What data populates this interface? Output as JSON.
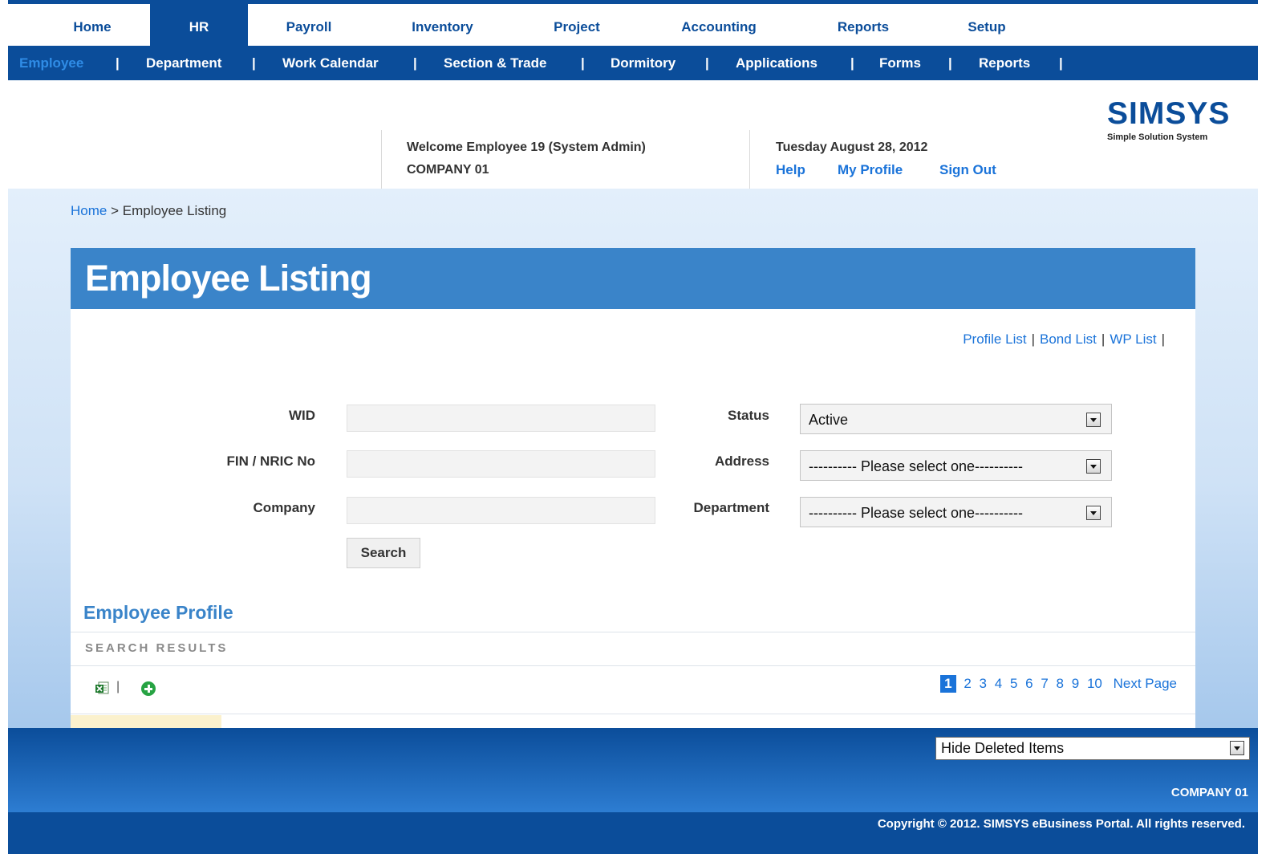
{
  "main_nav": {
    "tabs": [
      {
        "label": "Home"
      },
      {
        "label": "HR",
        "active": true
      },
      {
        "label": "Payroll"
      },
      {
        "label": "Inventory"
      },
      {
        "label": "Project"
      },
      {
        "label": "Accounting"
      },
      {
        "label": "Reports"
      },
      {
        "label": "Setup"
      }
    ]
  },
  "sub_nav": {
    "items": [
      {
        "label": "Employee",
        "active": true
      },
      {
        "label": "Department"
      },
      {
        "label": "Work Calendar"
      },
      {
        "label": "Section & Trade"
      },
      {
        "label": "Dormitory"
      },
      {
        "label": "Applications"
      },
      {
        "label": "Forms"
      },
      {
        "label": "Reports"
      }
    ],
    "separator": "|"
  },
  "header": {
    "welcome": "Welcome Employee 19 (System Admin)",
    "company": "COMPANY 01",
    "date": "Tuesday August 28, 2012",
    "links": {
      "help": "Help",
      "profile": "My Profile",
      "signout": "Sign Out"
    },
    "logo": {
      "main": "SIMSYS",
      "sub": "Simple Solution System"
    }
  },
  "breadcrumb": {
    "home": "Home",
    "separator": ">",
    "current": "Employee Listing"
  },
  "panel": {
    "title": "Employee Listing",
    "links": {
      "profile": "Profile List",
      "bond": "Bond List",
      "wp": "WP List",
      "separator": "|"
    }
  },
  "form": {
    "wid": {
      "label": "WID",
      "value": ""
    },
    "fin": {
      "label": "FIN / NRIC No",
      "value": ""
    },
    "company": {
      "label": "Company",
      "value": ""
    },
    "status": {
      "label": "Status",
      "value": "Active"
    },
    "address": {
      "label": "Address",
      "value": "---------- Please select one----------"
    },
    "department": {
      "label": "Department",
      "value": "---------- Please select one----------"
    },
    "search_button": "Search"
  },
  "results": {
    "section_title": "Employee Profile",
    "label": "SEARCH RESULTS",
    "toolbar_separator": "|",
    "pager": {
      "pages": [
        "1",
        "2",
        "3",
        "4",
        "5",
        "6",
        "7",
        "8",
        "9",
        "10"
      ],
      "current": "1",
      "next": "Next Page"
    }
  },
  "footer": {
    "filter_value": "Hide Deleted Items",
    "company": "COMPANY 01",
    "copyright": "Copyright © 2012. SIMSYS eBusiness Portal. All rights reserved."
  },
  "colors": {
    "brand": "#0b4d9a",
    "accent": "#3a84c9",
    "link": "#1a73d9"
  }
}
